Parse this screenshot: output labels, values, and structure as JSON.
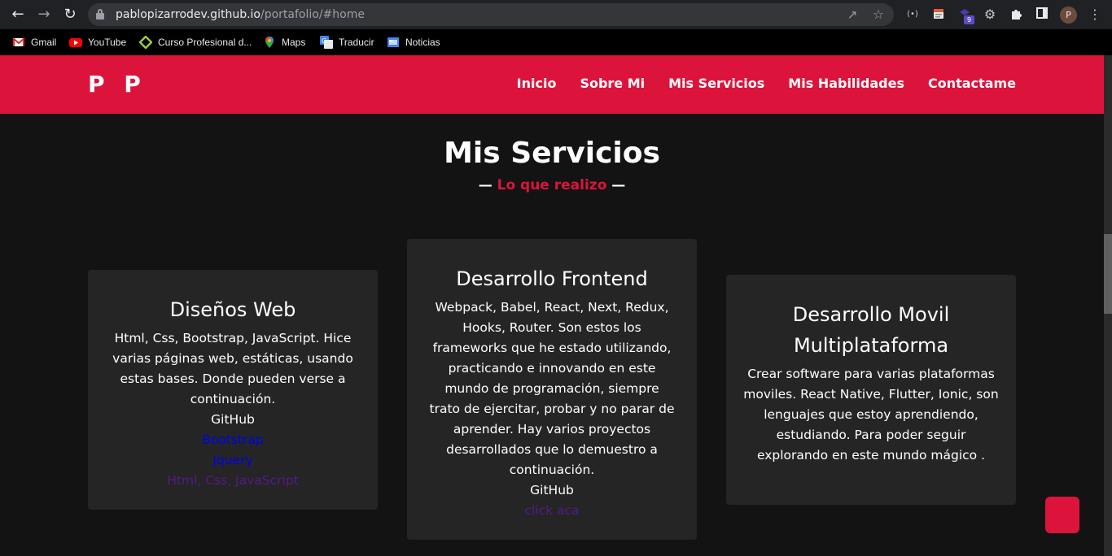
{
  "browser": {
    "url_host": "pablopizarrodev.github.io",
    "url_path": "/portafolio/#home",
    "profile_initial": "P",
    "extension_badge": "9"
  },
  "bookmarks": [
    {
      "label": "Gmail",
      "icon": "gmail-icon"
    },
    {
      "label": "YouTube",
      "icon": "youtube-icon"
    },
    {
      "label": "Curso Profesional d...",
      "icon": "course-icon"
    },
    {
      "label": "Maps",
      "icon": "maps-icon"
    },
    {
      "label": "Traducir",
      "icon": "translate-icon"
    },
    {
      "label": "Noticias",
      "icon": "news-icon"
    }
  ],
  "site": {
    "logo": "P P",
    "nav": [
      "Inicio",
      "Sobre Mi",
      "Mis Servicios",
      "Mis Habilidades",
      "Contactame"
    ],
    "section_title": "Mis Servicios",
    "subtitle_dash": "—",
    "subtitle": "Lo que realizo"
  },
  "cards": [
    {
      "title": "Diseños Web",
      "text": "Html, Css, Bootstrap, JavaScript. Hice varias páginas web, estáticas, usando estas bases. Donde pueden verse a continuación.",
      "label": "GitHub",
      "links": [
        "Bootstrap",
        "Jquery",
        "Html, Css, JavaScript"
      ]
    },
    {
      "title": "Desarrollo Frontend",
      "text": "Webpack, Babel, React, Next, Redux, Hooks, Router. Son estos los frameworks que he estado utilizando, practicando e innovando en este mundo de programación, siempre trato de ejercitar, probar y no parar de aprender. Hay varios proyectos desarrollados que lo demuestro a continuación.",
      "label": "GitHub",
      "links": [
        "click aca"
      ]
    },
    {
      "title": "Desarrollo Movil Multiplataforma",
      "text": "Crear software para varias plataformas moviles. React Native, Flutter, Ionic, son lenguajes que estoy aprendiendo, estudiando. Para poder seguir explorando en este mundo mágico ."
    }
  ],
  "colors": {
    "accent": "#dc143c",
    "background": "#131313",
    "card": "#252525",
    "link_unvisited": "#0000ee",
    "link_visited": "#551a8b"
  }
}
